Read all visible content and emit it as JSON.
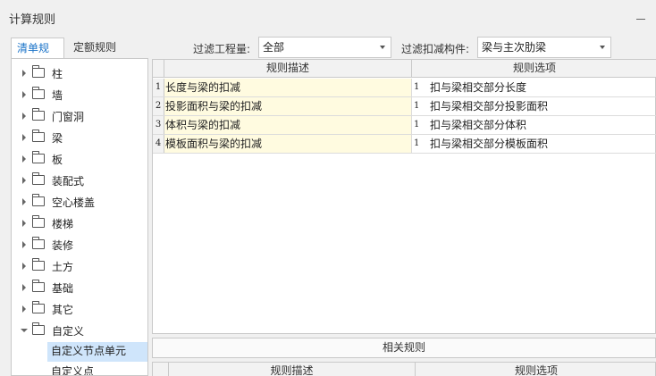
{
  "window": {
    "title": "计算规则"
  },
  "tabs": [
    {
      "label": "清单规则",
      "active": true
    },
    {
      "label": "定额规则",
      "active": false
    }
  ],
  "filters": {
    "quantity_label": "过滤工程量:",
    "quantity_value": "全部",
    "component_label": "过滤扣减构件:",
    "component_value": "梁与主次肋梁"
  },
  "tree": {
    "items": [
      {
        "label": "柱",
        "expanded": false
      },
      {
        "label": "墙",
        "expanded": false
      },
      {
        "label": "门窗洞",
        "expanded": false
      },
      {
        "label": "梁",
        "expanded": false
      },
      {
        "label": "板",
        "expanded": false
      },
      {
        "label": "装配式",
        "expanded": false
      },
      {
        "label": "空心楼盖",
        "expanded": false
      },
      {
        "label": "楼梯",
        "expanded": false
      },
      {
        "label": "装修",
        "expanded": false
      },
      {
        "label": "土方",
        "expanded": false
      },
      {
        "label": "基础",
        "expanded": false
      },
      {
        "label": "其它",
        "expanded": false
      },
      {
        "label": "自定义",
        "expanded": true
      }
    ],
    "children": [
      {
        "label": "自定义节点单元",
        "selected": true
      },
      {
        "label": "自定义点",
        "selected": false
      }
    ]
  },
  "grid": {
    "columns": [
      "规则描述",
      "规则选项"
    ],
    "rows": [
      {
        "num": "1",
        "desc": "长度与梁的扣减",
        "opt_num": "1",
        "opt": "扣与梁相交部分长度"
      },
      {
        "num": "2",
        "desc": "投影面积与梁的扣减",
        "opt_num": "1",
        "opt": "扣与梁相交部分投影面积"
      },
      {
        "num": "3",
        "desc": "体积与梁的扣减",
        "opt_num": "1",
        "opt": "扣与梁相交部分体积"
      },
      {
        "num": "4",
        "desc": "模板面积与梁的扣减",
        "opt_num": "1",
        "opt": "扣与梁相交部分模板面积"
      }
    ]
  },
  "related": {
    "title": "相关规则",
    "columns": [
      "规则描述",
      "规则选项"
    ]
  },
  "colors": {
    "accent": "#1a73c8",
    "selection": "#cfe5fb",
    "desc_cell": "#fffbe0"
  }
}
